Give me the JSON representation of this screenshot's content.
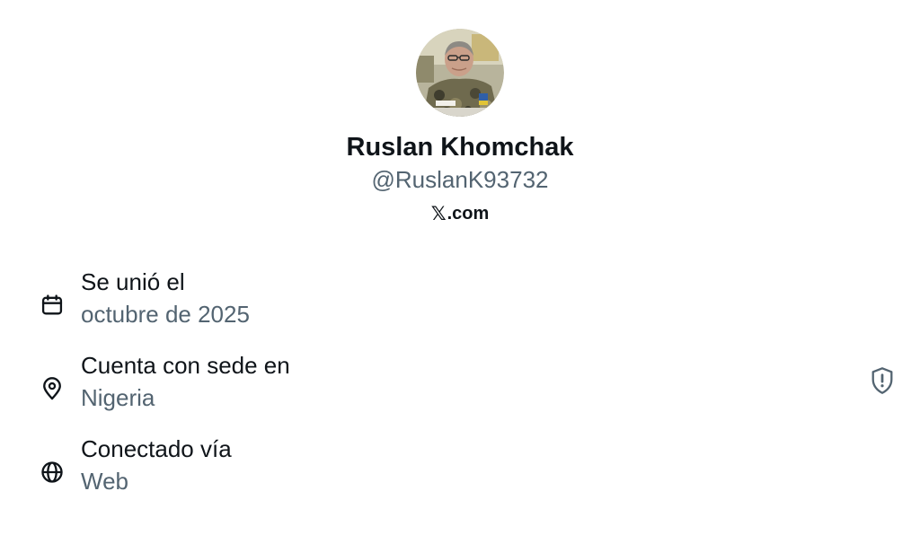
{
  "profile": {
    "display_name": "Ruslan Khomchak",
    "handle": "@RuslanK93732",
    "domain_glyph": "𝕏",
    "domain_suffix": ".com"
  },
  "about": {
    "joined": {
      "icon": "calendar-icon",
      "title": "Se unió el",
      "value": "octubre de 2025"
    },
    "location": {
      "icon": "location-pin-icon",
      "title": "Cuenta con sede en",
      "value": "Nigeria"
    },
    "connected": {
      "icon": "globe-icon",
      "title": "Conectado vía",
      "value": "Web"
    }
  },
  "indicators": {
    "shield_icon": "shield-alert-icon"
  },
  "colors": {
    "primary_text": "#0f1419",
    "secondary_text": "#536471",
    "background": "#ffffff"
  }
}
